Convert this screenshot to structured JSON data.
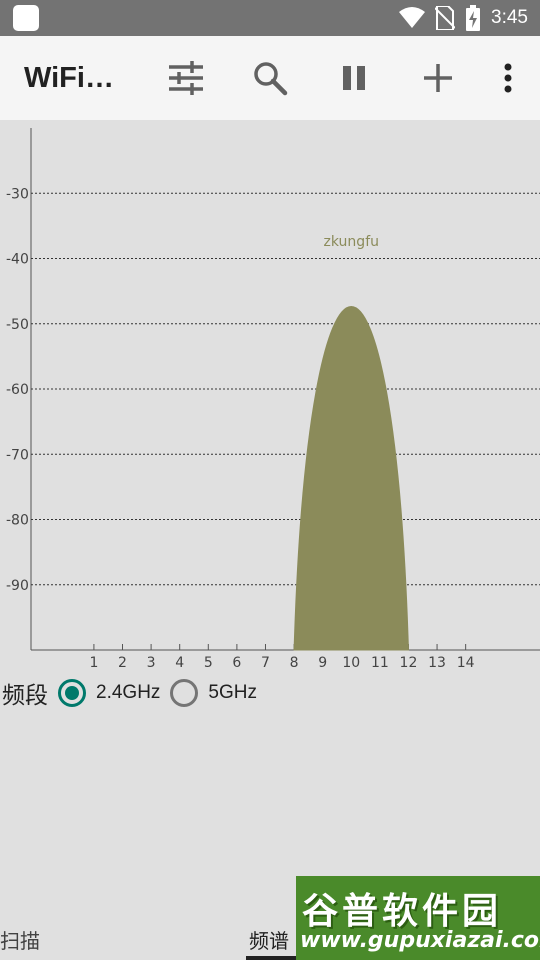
{
  "status_bar": {
    "time": "3:45",
    "icons": [
      "app-icon",
      "wifi-icon",
      "no-sim-icon",
      "battery-icon"
    ]
  },
  "appbar": {
    "title": "WiFi…",
    "actions": [
      "filter-icon",
      "search-icon",
      "pause-icon",
      "add-icon",
      "more-vert-icon"
    ]
  },
  "chart_data": {
    "type": "area",
    "x": {
      "ticks": [
        1,
        2,
        3,
        4,
        5,
        6,
        7,
        8,
        9,
        10,
        11,
        12,
        13,
        14
      ],
      "range": [
        -1.2,
        16.6
      ]
    },
    "y": {
      "ticks": [
        -30,
        -40,
        -50,
        -60,
        -70,
        -80,
        -90
      ],
      "range": [
        -100,
        -20
      ]
    },
    "grid": {
      "horizontal": true,
      "style": "dotted"
    },
    "series": [
      {
        "name": "zkungfu",
        "channel_center": 10,
        "channel_start": 8,
        "channel_end": 12,
        "signal_dbm": -39,
        "color": "#8b8b5a"
      }
    ]
  },
  "band": {
    "label": "频段",
    "options": [
      {
        "label": "2.4GHz",
        "checked": true
      },
      {
        "label": "5GHz",
        "checked": false
      }
    ]
  },
  "bottom_nav": {
    "items": [
      "扫描",
      "频谱"
    ],
    "active": "频谱"
  },
  "watermark": {
    "title": "谷普软件园",
    "url": "www.gupuxiazai.com"
  }
}
